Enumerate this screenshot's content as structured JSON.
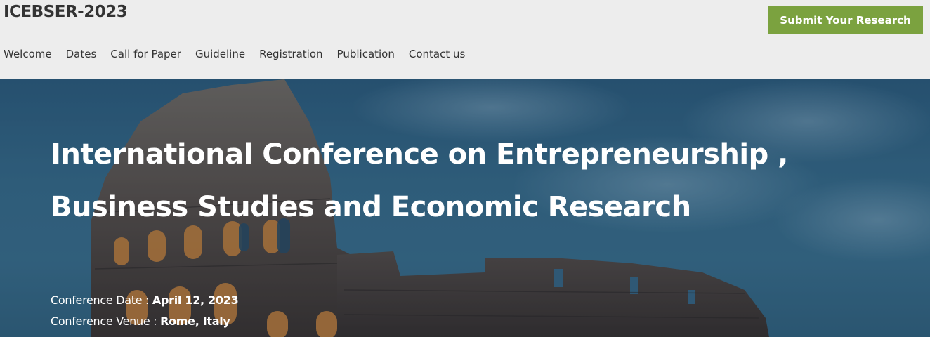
{
  "header": {
    "logo": "ICEBSER-2023",
    "submit_label": "Submit Your Research",
    "nav": [
      "Welcome",
      "Dates",
      "Call for Paper",
      "Guideline",
      "Registration",
      "Publication",
      "Contact us"
    ]
  },
  "hero": {
    "title": "International Conference on Entrepreneurship , Business Studies and Economic Research",
    "date_label": "Conference Date : ",
    "date_value": "April 12, 2023",
    "venue_label": "Conference Venue : ",
    "venue_value": "Rome, Italy"
  },
  "colors": {
    "header_bg": "#ededed",
    "accent": "#7ba23f",
    "sky": "#3a6f8e"
  }
}
